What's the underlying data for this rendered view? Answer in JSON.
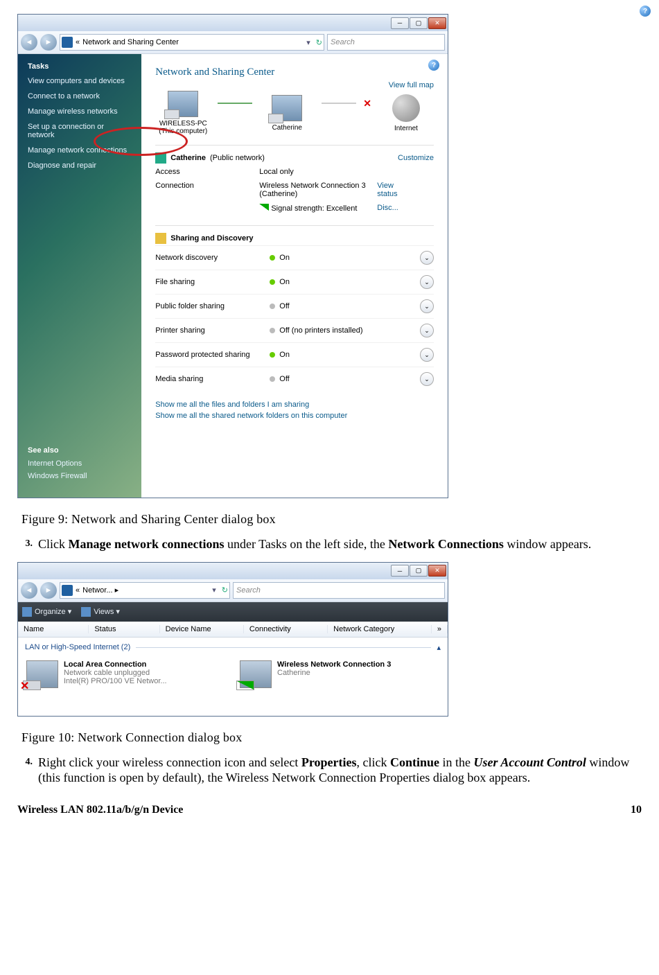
{
  "win1": {
    "breadcrumb_prefix": "«",
    "breadcrumb": "Network and Sharing Center",
    "search_placeholder": "Search",
    "sidebar": {
      "tasks_header": "Tasks",
      "tasks": [
        "View computers and devices",
        "Connect to a network",
        "Manage wireless networks",
        "Set up a connection or network",
        "Manage network connections",
        "Diagnose and repair"
      ],
      "see_also_header": "See also",
      "see_also": [
        "Internet Options",
        "Windows Firewall"
      ]
    },
    "main": {
      "title": "Network and Sharing Center",
      "view_map": "View full map",
      "nodes": {
        "pc": "WIRELESS-PC",
        "pc_sub": "(This computer)",
        "router": "Catherine",
        "internet": "Internet"
      },
      "network_name": "Catherine",
      "network_type": "(Public network)",
      "customize": "Customize",
      "rows": {
        "access_k": "Access",
        "access_v": "Local only",
        "conn_k": "Connection",
        "conn_v": "Wireless Network Connection 3 (Catherine)",
        "view_status": "View status",
        "signal_k": "Signal strength:",
        "signal_v": "Excellent",
        "disc": "Disc..."
      },
      "sharing_header": "Sharing and Discovery",
      "sharing": [
        {
          "k": "Network discovery",
          "on": true,
          "v": "On"
        },
        {
          "k": "File sharing",
          "on": true,
          "v": "On"
        },
        {
          "k": "Public folder sharing",
          "on": false,
          "v": "Off"
        },
        {
          "k": "Printer sharing",
          "on": false,
          "v": "Off (no printers installed)"
        },
        {
          "k": "Password protected sharing",
          "on": true,
          "v": "On"
        },
        {
          "k": "Media sharing",
          "on": false,
          "v": "Off"
        }
      ],
      "footlinks": [
        "Show me all the files and folders I am sharing",
        "Show me all the shared network folders on this computer"
      ]
    }
  },
  "captions": {
    "fig9": "Figure 9: Network and Sharing Center dialog box",
    "fig10": "Figure 10: Network Connection dialog box"
  },
  "step3": {
    "num": "3.",
    "pre": "Click ",
    "b1": "Manage network connections",
    "mid": " under Tasks on the left side, the ",
    "b2": "Network Connections",
    "post": " window appears."
  },
  "win2": {
    "breadcrumb_prefix": "«",
    "breadcrumb": "Networ...  ▸",
    "search_placeholder": "Search",
    "toolbar": {
      "organize": "Organize  ▾",
      "views": "Views   ▾"
    },
    "columns": [
      "Name",
      "Status",
      "Device Name",
      "Connectivity",
      "Network Category"
    ],
    "more": "»",
    "group": "LAN or High-Speed Internet (2)",
    "group_chev": "▴",
    "items": [
      {
        "name": "Local Area Connection",
        "l1": "Network cable unplugged",
        "l2": "Intel(R) PRO/100 VE Networ...",
        "x": true
      },
      {
        "name": "Wireless Network Connection 3",
        "l1": "Catherine",
        "l2": "",
        "x": false
      }
    ]
  },
  "step4": {
    "num": "4.",
    "pre": "Right click your wireless connection icon and select ",
    "b1": "Properties",
    "m1": ", click ",
    "b2": "Continue",
    "m2": " in the ",
    "b3": "User Account Control",
    "post": " window (this function is open by default), the Wireless Network Connection Properties dialog box appears."
  },
  "footer": {
    "left": "Wireless LAN 802.11a/b/g/n Device",
    "right": "10"
  }
}
